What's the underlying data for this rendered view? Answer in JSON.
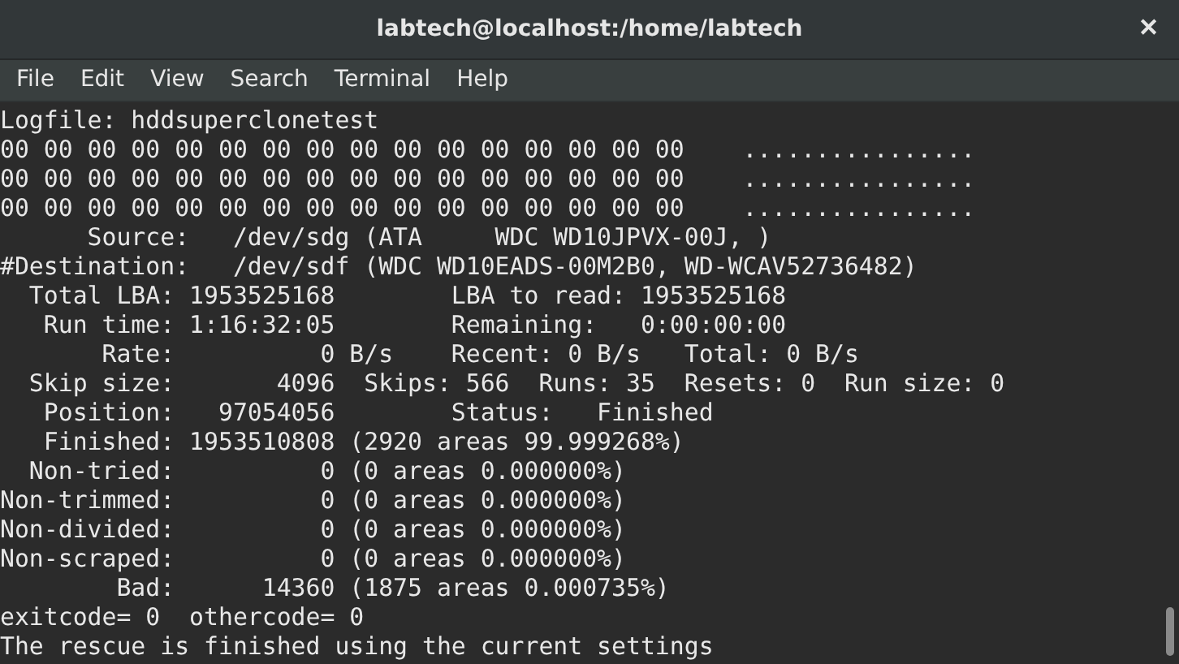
{
  "window": {
    "title": "labtech@localhost:/home/labtech",
    "close": "✕"
  },
  "menu": [
    "File",
    "Edit",
    "View",
    "Search",
    "Terminal",
    "Help"
  ],
  "terminal": {
    "lines": [
      "Logfile: hddsuperclonetest",
      "00 00 00 00 00 00 00 00 00 00 00 00 00 00 00 00    ................",
      "00 00 00 00 00 00 00 00 00 00 00 00 00 00 00 00    ................",
      "00 00 00 00 00 00 00 00 00 00 00 00 00 00 00 00    ................",
      "      Source:   /dev/sdg (ATA     WDC WD10JPVX-00J, )",
      "#Destination:   /dev/sdf (WDC WD10EADS-00M2B0, WD-WCAV52736482)",
      "  Total LBA: 1953525168        LBA to read: 1953525168",
      "   Run time: 1:16:32:05        Remaining:   0:00:00:00",
      "       Rate:          0 B/s    Recent: 0 B/s   Total: 0 B/s",
      "  Skip size:       4096  Skips: 566  Runs: 35  Resets: 0  Run size: 0",
      "   Position:   97054056        Status:   Finished",
      "   Finished: 1953510808 (2920 areas 99.999268%)",
      "  Non-tried:          0 (0 areas 0.000000%)",
      "Non-trimmed:          0 (0 areas 0.000000%)",
      "Non-divided:          0 (0 areas 0.000000%)",
      "Non-scraped:          0 (0 areas 0.000000%)",
      "        Bad:      14360 (1875 areas 0.000735%)",
      "exitcode= 0  othercode= 0",
      "The rescue is finished using the current settings"
    ]
  }
}
